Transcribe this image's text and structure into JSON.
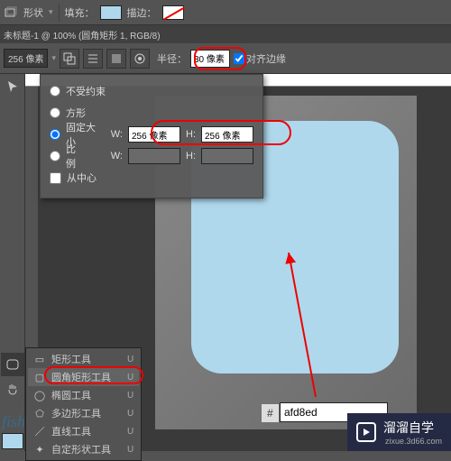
{
  "topbar": {
    "shape_label": "形状",
    "fill_label": "填充：",
    "stroke_label": "描边："
  },
  "title": "未标题-1 @ 100% (圆角矩形 1, RGB/8)",
  "options": {
    "px_value": "256 像素",
    "radius_label": "半径：",
    "radius_value": "30 像素",
    "align_label": "对齐边缘"
  },
  "size_panel": {
    "opt_unconstrained": "不受约束",
    "opt_square": "方形",
    "opt_fixed": "固定大小",
    "opt_ratio": "比例",
    "opt_center": "从中心",
    "w_label": "W:",
    "h_label": "H:",
    "w_value": "256 像素",
    "h_value": "256 像素"
  },
  "flyout": {
    "items": [
      {
        "label": "矩形工具",
        "short": "U"
      },
      {
        "label": "圆角矩形工具",
        "short": "U"
      },
      {
        "label": "椭圆工具",
        "short": "U"
      },
      {
        "label": "多边形工具",
        "short": "U"
      },
      {
        "label": "直线工具",
        "short": "U"
      },
      {
        "label": "自定形状工具",
        "short": "U"
      }
    ]
  },
  "color": {
    "hash": "#",
    "hex": "afd8ed"
  },
  "watermark": {
    "brand": "溜溜自学",
    "url": "zixue.3d66.com"
  },
  "fish": "fish"
}
